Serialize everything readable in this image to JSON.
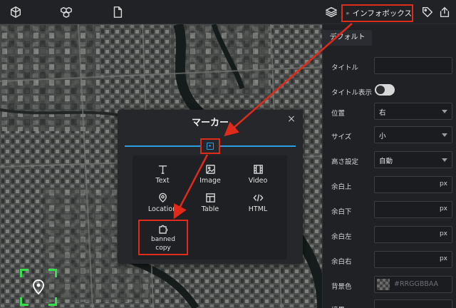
{
  "toolbar": {
    "left_icons": [
      "cube-outline-icon",
      "cubes-icon",
      "document-icon"
    ],
    "right_icons": [
      "layers-icon",
      "infobox-icon",
      "tag-icon",
      "share-icon"
    ],
    "infobox_label": "インフォボックス"
  },
  "dialog": {
    "title": "マーカー",
    "close_glyph": "×",
    "blocks": [
      {
        "label": "Text",
        "icon": "text-icon"
      },
      {
        "label": "Image",
        "icon": "image-icon"
      },
      {
        "label": "Video",
        "icon": "video-icon"
      },
      {
        "label": "Location",
        "icon": "location-icon"
      },
      {
        "label": "Table",
        "icon": "table-icon"
      },
      {
        "label": "HTML",
        "icon": "code-icon"
      }
    ],
    "banned": {
      "line1": "banned",
      "line2": "copy",
      "icon": "puzzle-icon"
    }
  },
  "panel": {
    "tab": "デフォルト",
    "title_label": "タイトル",
    "title_value": "",
    "show_title_label": "タイトル表示",
    "show_title_on": true,
    "position_label": "位置",
    "position_value": "右",
    "size_label": "サイズ",
    "size_value": "小",
    "height_label": "高さ設定",
    "height_value": "自動",
    "margin_top_label": "余白上",
    "margin_bottom_label": "余白下",
    "margin_left_label": "余白左",
    "margin_right_label": "余白右",
    "unit": "px",
    "bg_label": "背景色",
    "bg_placeholder": "#RRGGBBAA",
    "border_label": "境界"
  },
  "colors": {
    "highlight": "#e02a1a",
    "accent": "#2d9fe0",
    "selection": "#35e04a"
  }
}
